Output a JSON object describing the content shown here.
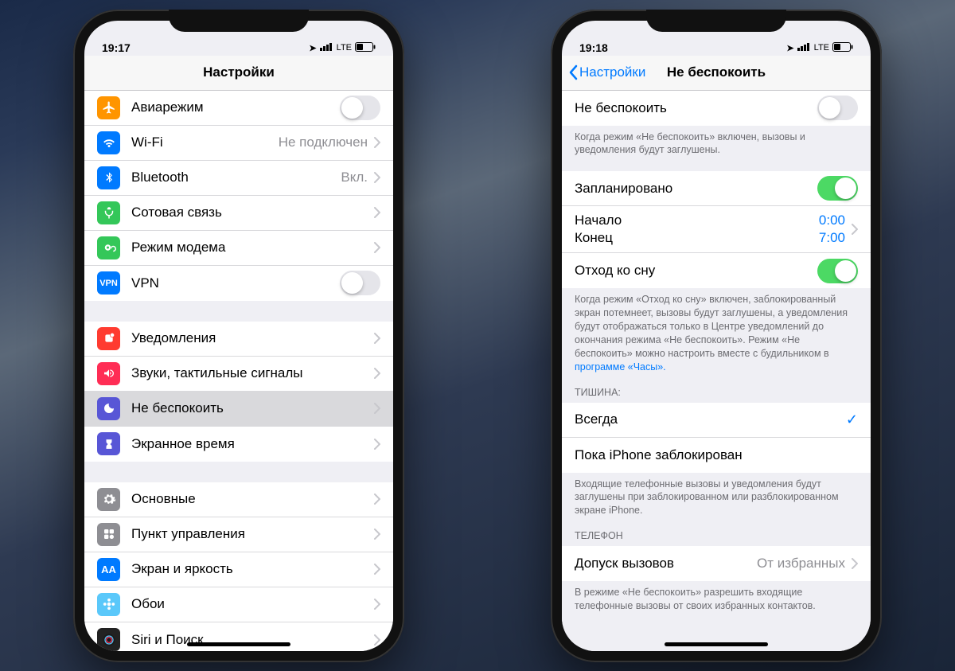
{
  "left": {
    "status": {
      "time": "19:17",
      "cell": "LTE"
    },
    "nav": {
      "title": "Настройки"
    },
    "groups": [
      {
        "rows": [
          {
            "icon": "airplane",
            "iconColor": "#ff9500",
            "label": "Авиарежим",
            "control": "toggle",
            "on": false
          },
          {
            "icon": "wifi",
            "iconColor": "#007aff",
            "label": "Wi-Fi",
            "value": "Не подключен",
            "nav": true
          },
          {
            "icon": "bluetooth",
            "iconColor": "#007aff",
            "label": "Bluetooth",
            "value": "Вкл.",
            "nav": true
          },
          {
            "icon": "cellular",
            "iconColor": "#34c759",
            "label": "Сотовая связь",
            "nav": true
          },
          {
            "icon": "hotspot",
            "iconColor": "#34c759",
            "label": "Режим модема",
            "nav": true
          },
          {
            "icon": "vpn",
            "iconColor": "#007aff",
            "label": "VPN",
            "control": "toggle",
            "on": false
          }
        ]
      },
      {
        "rows": [
          {
            "icon": "notifications",
            "iconColor": "#ff3b30",
            "label": "Уведомления",
            "nav": true
          },
          {
            "icon": "sounds",
            "iconColor": "#ff2d55",
            "label": "Звуки, тактильные сигналы",
            "nav": true
          },
          {
            "icon": "dnd",
            "iconColor": "#5856d6",
            "label": "Не беспокоить",
            "nav": true,
            "selected": true
          },
          {
            "icon": "screentime",
            "iconColor": "#5856d6",
            "label": "Экранное время",
            "nav": true
          }
        ]
      },
      {
        "rows": [
          {
            "icon": "general",
            "iconColor": "#8e8e93",
            "label": "Основные",
            "nav": true
          },
          {
            "icon": "controlcenter",
            "iconColor": "#8e8e93",
            "label": "Пункт управления",
            "nav": true
          },
          {
            "icon": "display",
            "iconColor": "#007aff",
            "label": "Экран и яркость",
            "nav": true
          },
          {
            "icon": "wallpaper",
            "iconColor": "#5ac8fa",
            "label": "Обои",
            "nav": true
          },
          {
            "icon": "siri",
            "iconColor": "#222",
            "label": "Siri и Поиск",
            "nav": true
          }
        ]
      }
    ]
  },
  "right": {
    "status": {
      "time": "19:18",
      "cell": "LTE"
    },
    "nav": {
      "back": "Настройки",
      "title": "Не беспокоить"
    },
    "g1": {
      "row1": {
        "label": "Не беспокоить",
        "on": false
      },
      "footer": "Когда режим «Не беспокоить» включен, вызовы и уведомления будут заглушены."
    },
    "g2": {
      "row1": {
        "label": "Запланировано",
        "on": true
      },
      "row2": {
        "k1": "Начало",
        "v1": "0:00",
        "k2": "Конец",
        "v2": "7:00"
      },
      "row3": {
        "label": "Отход ко сну",
        "on": true
      },
      "footer": "Когда режим «Отход ко сну» включен, заблокированный экран потемнеет, вызовы будут заглушены, а уведомления будут отображаться только в Центре уведомлений до окончания режима «Не беспокоить». Режим «Не беспокоить» можно настроить вместе с будильником в ",
      "footerLink": "программе «Часы».",
      "footer2": ""
    },
    "g3": {
      "header": "Тишина:",
      "row1": {
        "label": "Всегда",
        "checked": true
      },
      "row2": {
        "label": "Пока iPhone заблокирован",
        "checked": false
      },
      "footer": "Входящие телефонные вызовы и уведомления будут заглушены при заблокированном или разблокированном экране iPhone."
    },
    "g4": {
      "header": "Телефон",
      "row1": {
        "label": "Допуск вызовов",
        "value": "От избранных"
      },
      "footer": "В режиме «Не беспокоить» разрешить входящие телефонные вызовы от своих избранных контактов."
    }
  },
  "icons": {
    "airplane": "✈",
    "wifi": "wifi",
    "bluetooth": "bt",
    "cellular": "ant",
    "hotspot": "link",
    "vpn": "VPN",
    "notifications": "sq",
    "sounds": "snd",
    "dnd": "moon",
    "screentime": "hour",
    "general": "gear",
    "controlcenter": "cc",
    "display": "AA",
    "wallpaper": "flower",
    "siri": "siri"
  }
}
